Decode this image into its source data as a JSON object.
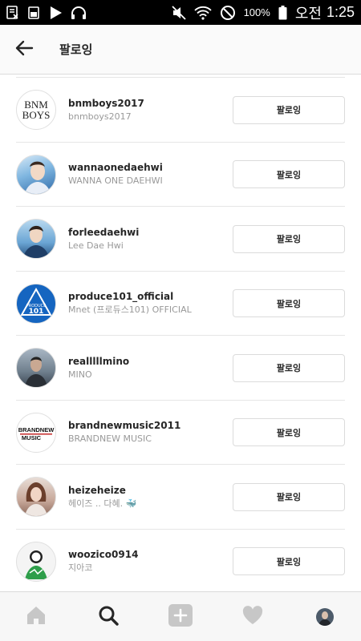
{
  "status_bar": {
    "battery_percent": "100%",
    "ampm": "오전",
    "time": "1:25",
    "icons": [
      "sim-icon",
      "battery-saver-icon",
      "play-icon",
      "headphones-icon",
      "mute-icon",
      "wifi-icon",
      "blocked-icon"
    ]
  },
  "header": {
    "title": "팔로잉",
    "back_icon": "back-arrow-icon"
  },
  "following": [
    {
      "username": "bnmboys2017",
      "full_name": "bnmboys2017",
      "button": "팔로잉",
      "avatar": "bnm-boys-logo"
    },
    {
      "username": "wannaonedaehwi",
      "full_name": "WANNA ONE DAEHWI",
      "button": "팔로잉",
      "avatar": "profile-photo"
    },
    {
      "username": "forleedaehwi",
      "full_name": "Lee Dae Hwi",
      "button": "팔로잉",
      "avatar": "profile-photo"
    },
    {
      "username": "produce101_official",
      "full_name": "Mnet (프로듀스101) OFFICIAL",
      "button": "팔로잉",
      "avatar": "produce101-logo"
    },
    {
      "username": "realllllmino",
      "full_name": "MINO",
      "button": "팔로잉",
      "avatar": "profile-photo"
    },
    {
      "username": "brandnewmusic2011",
      "full_name": "BRANDNEW MUSIC",
      "button": "팔로잉",
      "avatar": "brandnew-music-logo"
    },
    {
      "username": "heizeheize",
      "full_name": "헤이즈 .. 다혜. 🐳",
      "button": "팔로잉",
      "avatar": "profile-photo"
    },
    {
      "username": "woozico0914",
      "full_name": "지아코",
      "button": "팔로잉",
      "avatar": "profile-photo"
    }
  ],
  "logos": {
    "bnm_line1": "BNM",
    "bnm_line2": "BOYS",
    "produce_top": "PRODUCE",
    "produce_num": "101",
    "brandnew_line1": "BRANDNEW",
    "brandnew_line2": "MUSIC"
  },
  "bottom_nav": [
    {
      "name": "home-icon",
      "active": false
    },
    {
      "name": "search-icon",
      "active": true
    },
    {
      "name": "add-post-icon",
      "active": false
    },
    {
      "name": "activity-heart-icon",
      "active": false
    },
    {
      "name": "profile-avatar",
      "active": false
    }
  ],
  "colors": {
    "text": "#262626",
    "secondary_text": "#999999",
    "border": "#dbdbdb",
    "produce_blue": "#1565c0",
    "nav_inactive": "#c7c7c7"
  }
}
